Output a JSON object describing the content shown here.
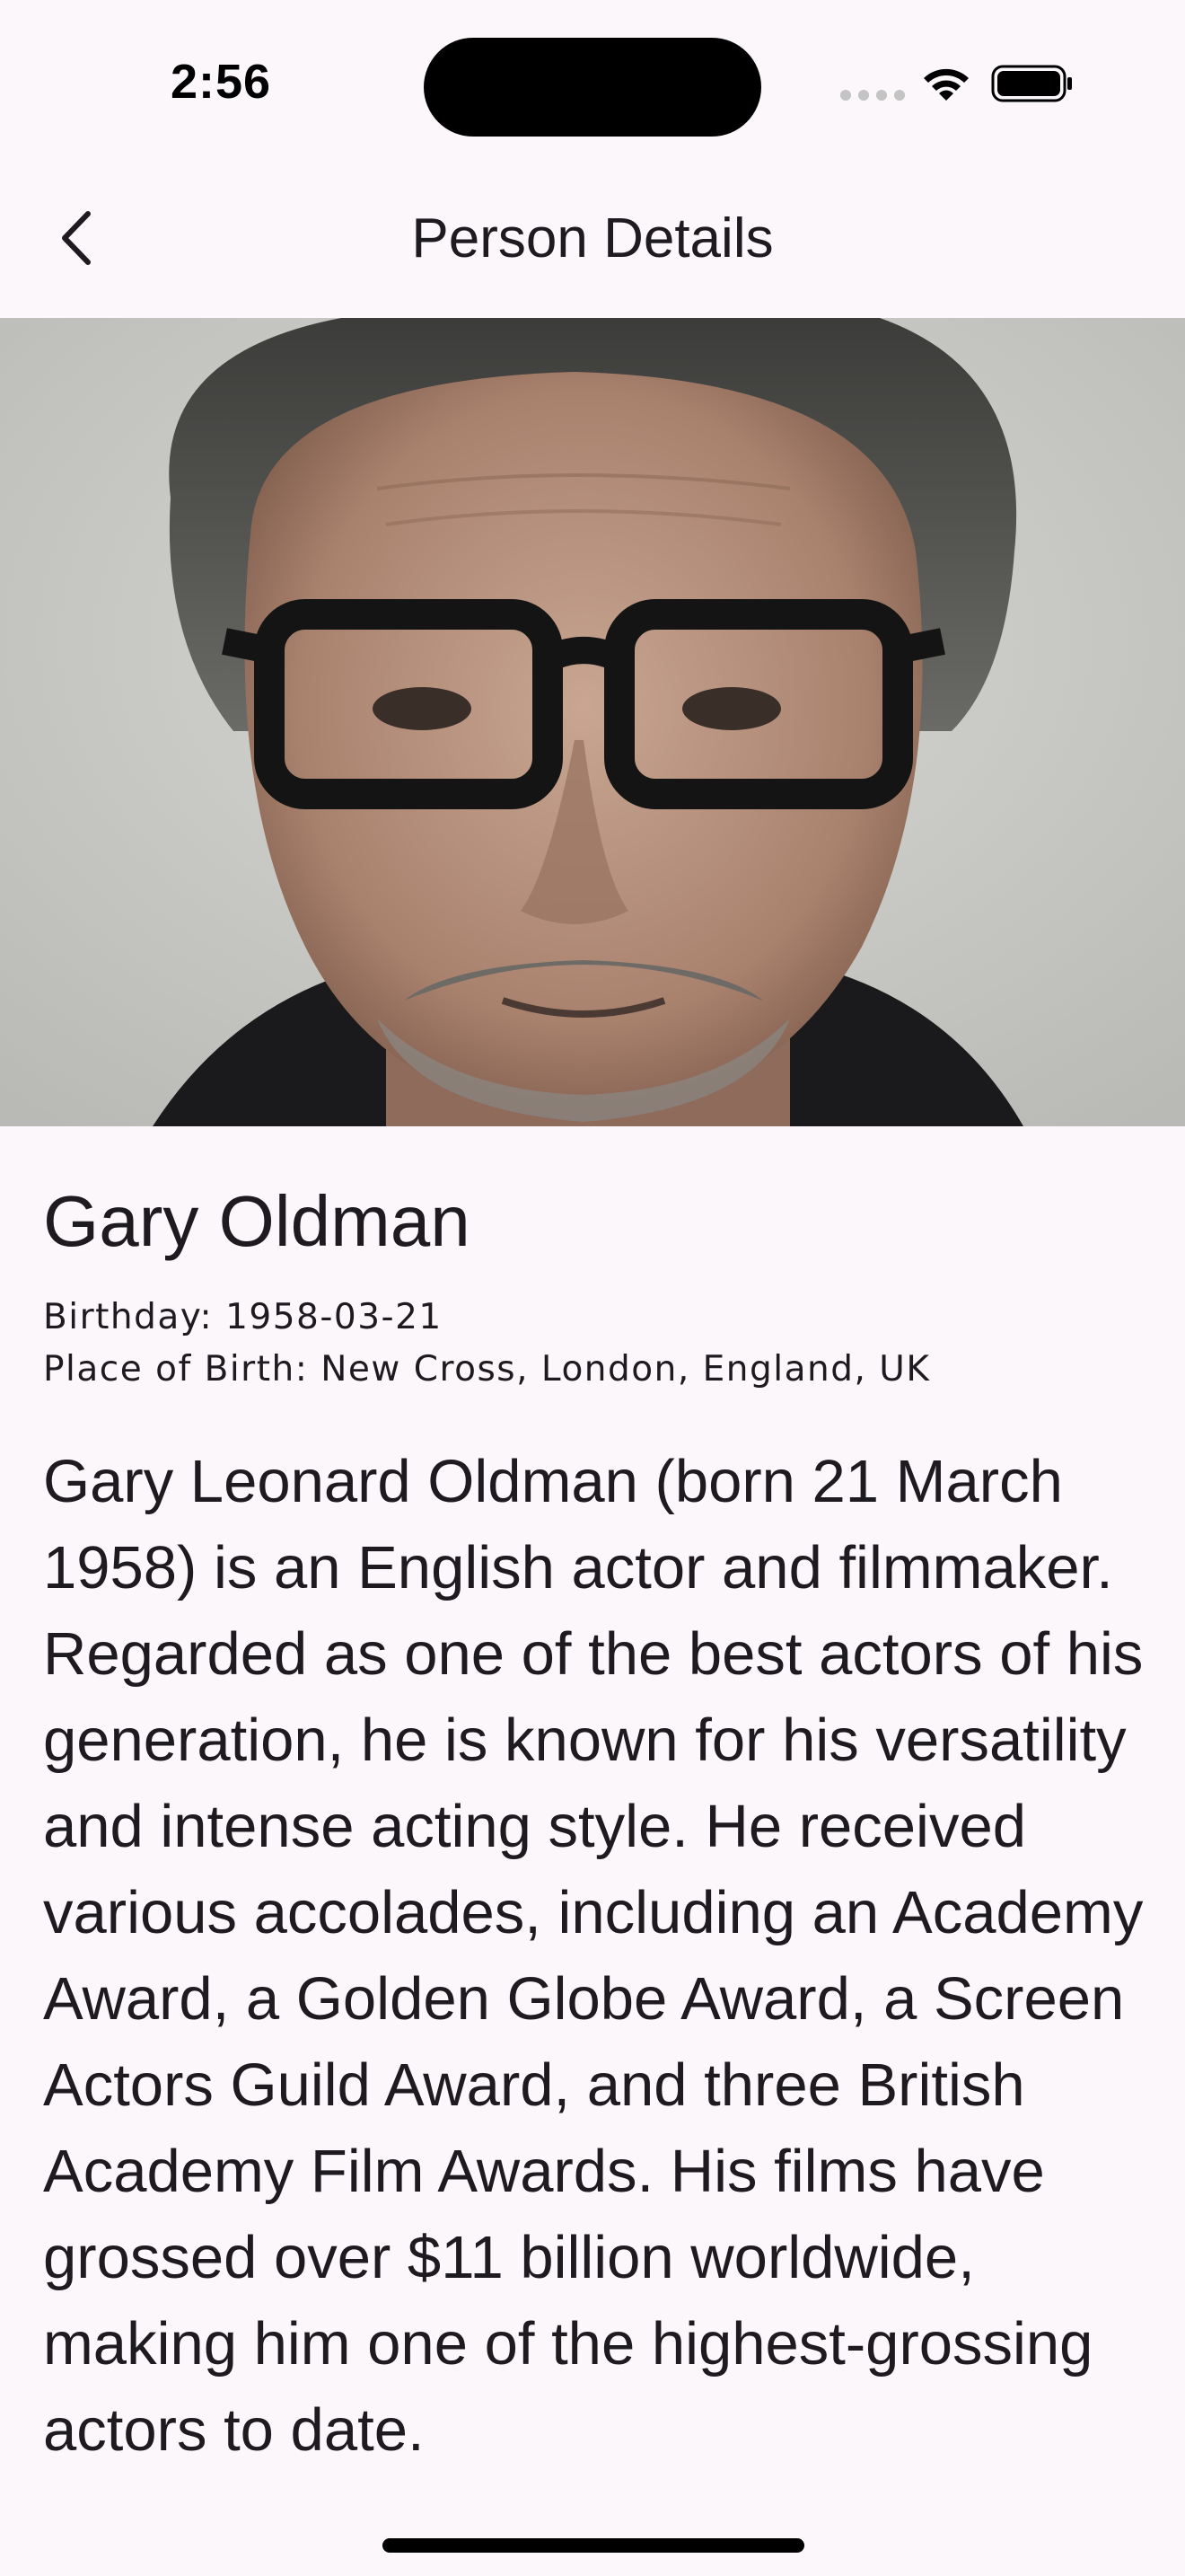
{
  "status_bar": {
    "time": "2:56"
  },
  "app_bar": {
    "title": "Person Details",
    "back_icon": "chevron-left-icon"
  },
  "person": {
    "name": "Gary Oldman",
    "birthday": "Birthday: 1958-03-21",
    "place_of_birth": "Place of Birth: New Cross, London, England, UK",
    "biography": "Gary Leonard Oldman (born 21 March 1958) is an English actor and filmmaker. Regarded as one of the best actors of his generation, he is known for his versatility and intense acting style. He received various accolades, including an Academy Award, a Golden Globe Award, a Screen Actors Guild Award, and three British Academy Film Awards. His films have grossed over $11 billion worldwide, making him one of the highest-grossing actors to date."
  },
  "colors": {
    "background": "#fcf7fb",
    "text": "#1d1b20"
  }
}
